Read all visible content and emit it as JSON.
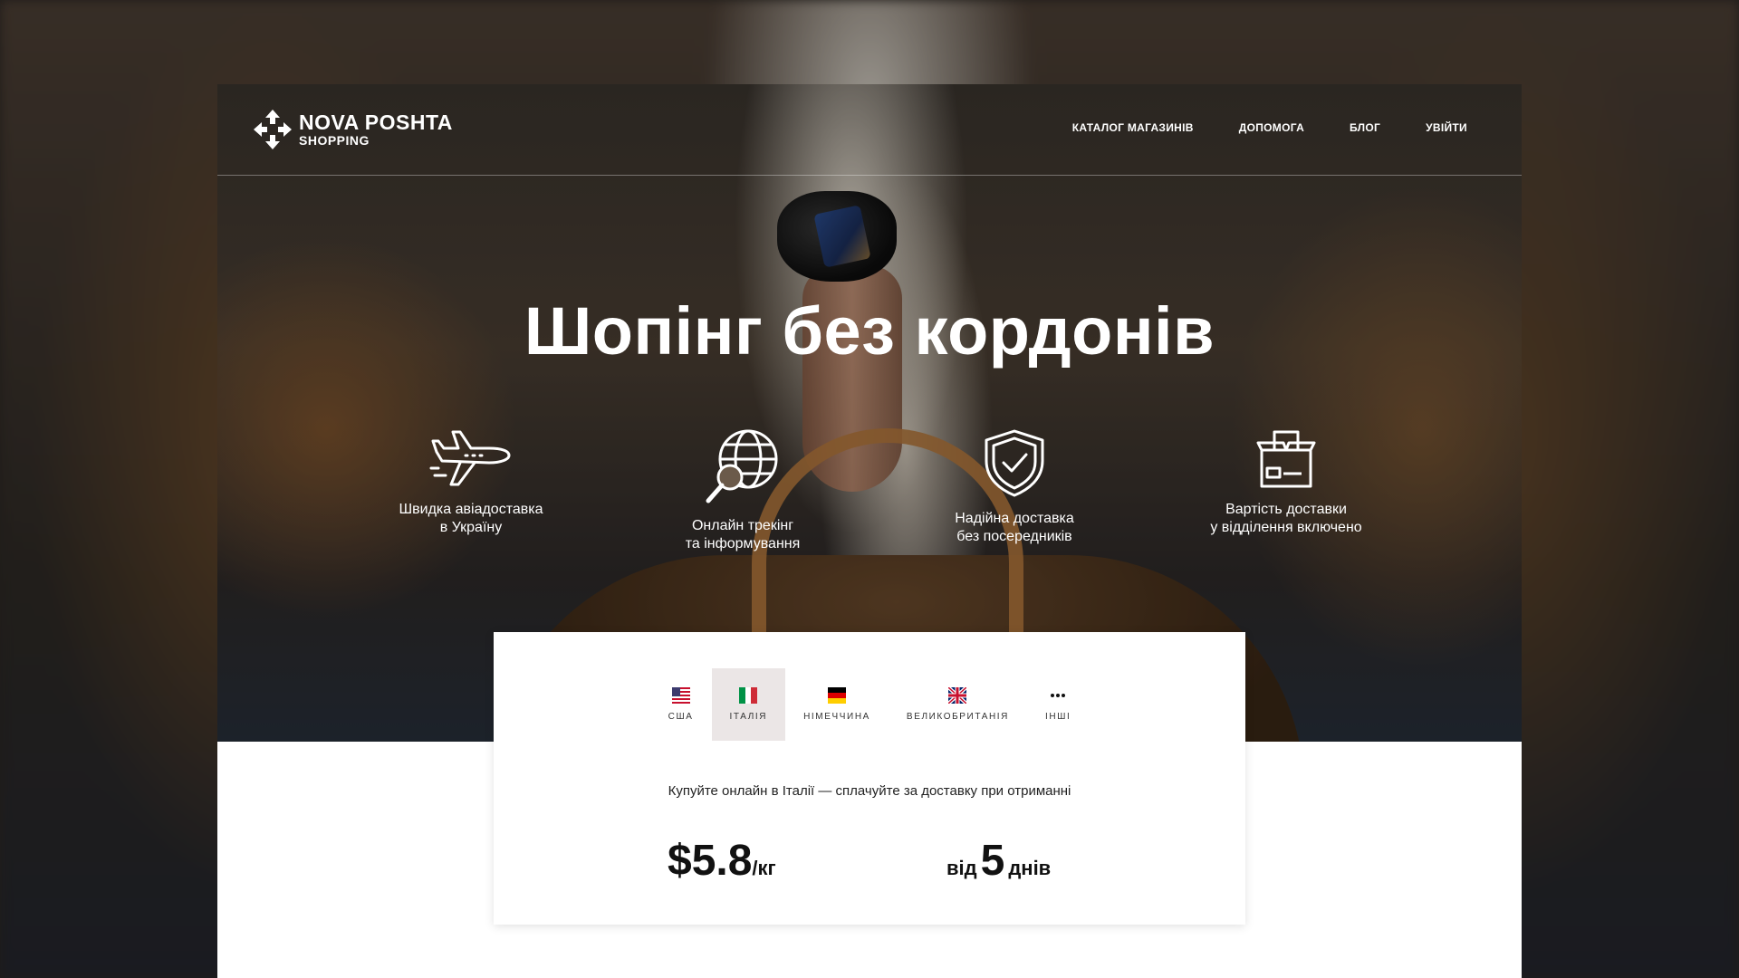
{
  "brand": {
    "name_line1": "NOVA POSHTA",
    "name_line2": "SHOPPING",
    "logo_icon": "nova-poshta-arrows-icon"
  },
  "nav": {
    "items": [
      {
        "label": "КАТАЛОГ МАГАЗИНІВ"
      },
      {
        "label": "ДОПОМОГА"
      },
      {
        "label": "БЛОГ"
      },
      {
        "label": "УВІЙТИ"
      }
    ]
  },
  "hero": {
    "title": "Шопінг без кордонів"
  },
  "features": [
    {
      "icon": "airplane-icon",
      "line1": "Швидка авіадоставка",
      "line2": "в Україну"
    },
    {
      "icon": "globe-search-icon",
      "line1": "Онлайн трекінг",
      "line2": "та інформування"
    },
    {
      "icon": "shield-check-icon",
      "line1": "Надійна доставка",
      "line2": "без посередників"
    },
    {
      "icon": "package-icon",
      "line1": "Вартість доставки",
      "line2": "у відділення включено"
    }
  ],
  "country_tabs": {
    "selected": "ІТАЛІЯ",
    "items": [
      {
        "label": "США",
        "icon": "us-flag-icon"
      },
      {
        "label": "ІТАЛІЯ",
        "icon": "italy-flag-icon"
      },
      {
        "label": "НІМЕЧЧИНА",
        "icon": "germany-flag-icon"
      },
      {
        "label": "ВЕЛИКОБРИТАНІЯ",
        "icon": "uk-flag-icon"
      },
      {
        "label": "ІНШІ",
        "icon": "more-dots-icon"
      }
    ]
  },
  "offer": {
    "description": "Купуйте онлайн в Італії — сплачуйте за доставку при отриманні",
    "price_value": "$5.8",
    "price_unit": "/кг",
    "days_prefix": "від",
    "days_number": "5",
    "days_suffix": "днів"
  },
  "colors": {
    "active_tab_bg": "#ebe6e6",
    "text_dark": "#111111",
    "hero_text": "#ffffff"
  }
}
